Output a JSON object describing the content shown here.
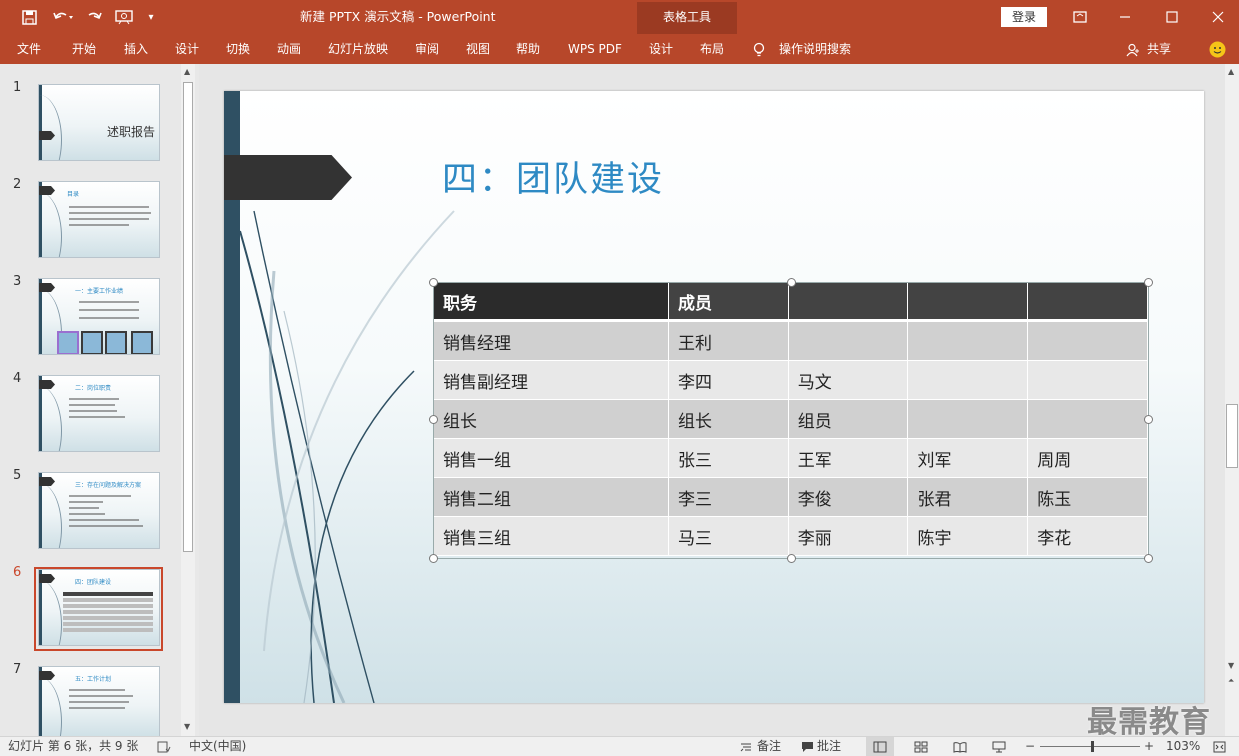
{
  "window": {
    "title": "新建 PPTX 演示文稿  -  PowerPoint",
    "context_tab": "表格工具",
    "login": "登录"
  },
  "quick_access": [
    "save-icon",
    "undo-icon",
    "redo-icon",
    "present-icon",
    "customize-icon"
  ],
  "ribbon": {
    "tabs": [
      "文件",
      "开始",
      "插入",
      "设计",
      "切换",
      "动画",
      "幻灯片放映",
      "审阅",
      "视图",
      "帮助",
      "WPS PDF",
      "设计",
      "布局"
    ],
    "search": "操作说明搜索",
    "share": "共享"
  },
  "thumbnails": [
    {
      "num": "1",
      "title": "述职报告"
    },
    {
      "num": "2",
      "title": "目录"
    },
    {
      "num": "3",
      "title": "一：主要工作业绩"
    },
    {
      "num": "4",
      "title": "二：岗位职责"
    },
    {
      "num": "5",
      "title": "三：存在问题及解决方案"
    },
    {
      "num": "6",
      "title": "四：团队建设"
    },
    {
      "num": "7",
      "title": "五：工作计划"
    }
  ],
  "selected_thumb": "6",
  "slide": {
    "title": "四：团队建设",
    "table": {
      "header": [
        "职务",
        "成员",
        "",
        "",
        ""
      ],
      "rows": [
        [
          "销售经理",
          "王利",
          "",
          "",
          ""
        ],
        [
          "销售副经理",
          "李四",
          "马文",
          "",
          ""
        ],
        [
          "组长",
          "组长",
          "组员",
          "",
          ""
        ],
        [
          "销售一组",
          "张三",
          "王军",
          "刘军",
          "周周"
        ],
        [
          "销售二组",
          "李三",
          "李俊",
          "张君",
          "陈玉"
        ],
        [
          "销售三组",
          "马三",
          "李丽",
          "陈宇",
          "李花"
        ]
      ]
    }
  },
  "status": {
    "slide_info": "幻灯片 第 6 张，共 9 张",
    "language": "中文(中国)",
    "notes": "备注",
    "comments": "批注",
    "zoom": "103%",
    "zoom_level_fraction": 0.52
  },
  "watermark": "最需教育",
  "colors": {
    "accent": "#b7472a",
    "title_blue": "#2e8ac4",
    "bar": "#2f5063"
  }
}
